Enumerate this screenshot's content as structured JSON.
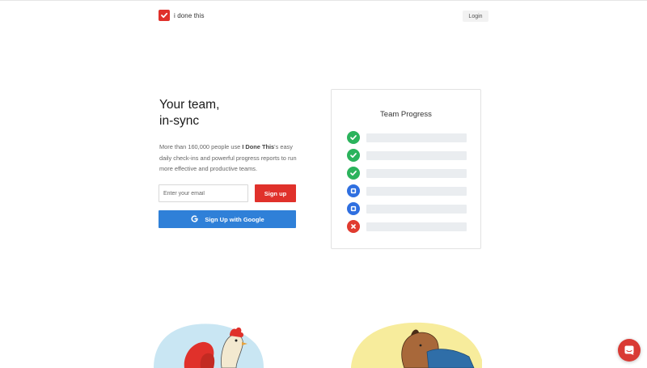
{
  "header": {
    "brand": "i done this",
    "login_label": "Login"
  },
  "hero": {
    "title_line1": "Your team,",
    "title_line2": "in-sync",
    "desc_before": "More than 160,000 people use ",
    "desc_brand": "I Done This",
    "desc_after": "'s easy daily check-ins and powerful progress reports to run more effective and productive teams.",
    "email_placeholder": "Enter your email",
    "signup_label": "Sign up",
    "google_label": "Sign Up with Google"
  },
  "card": {
    "title": "Team Progress",
    "items": [
      {
        "status": "done",
        "icon": "check-circle-icon"
      },
      {
        "status": "done",
        "icon": "check-circle-icon"
      },
      {
        "status": "done",
        "icon": "check-circle-icon"
      },
      {
        "status": "in-progress",
        "icon": "square-circle-icon"
      },
      {
        "status": "in-progress",
        "icon": "square-circle-icon"
      },
      {
        "status": "blocked",
        "icon": "x-circle-icon"
      }
    ]
  },
  "colors": {
    "brand_red": "#e0312b",
    "google_blue": "#2f80d8",
    "done_green": "#2bb35c",
    "progress_blue": "#2f6fe0",
    "blocked_red": "#e03b2f"
  }
}
